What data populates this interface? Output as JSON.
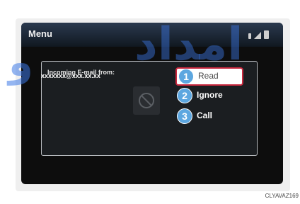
{
  "menu_bar": {
    "title": "Menu",
    "icons": [
      "bluetooth-icon",
      "signal-icon",
      "battery-icon"
    ]
  },
  "notification": {
    "title": "Incoming E-mail from:",
    "sender": "xxxxxxx@xxx.xx.xx",
    "image_icon": "no-sign-icon",
    "actions": [
      {
        "number": "1",
        "label": "Read",
        "selected": true
      },
      {
        "number": "2",
        "label": "Ignore",
        "selected": false
      },
      {
        "number": "3",
        "label": "Call",
        "selected": false
      }
    ]
  },
  "caption": "CLYAVAZ169",
  "watermark": {
    "left": "ﻭ",
    "right": "امداد"
  },
  "colors": {
    "number_badge": "#5da7e0",
    "selected_border": "#c9283e",
    "watermark": "#3c78e6"
  }
}
